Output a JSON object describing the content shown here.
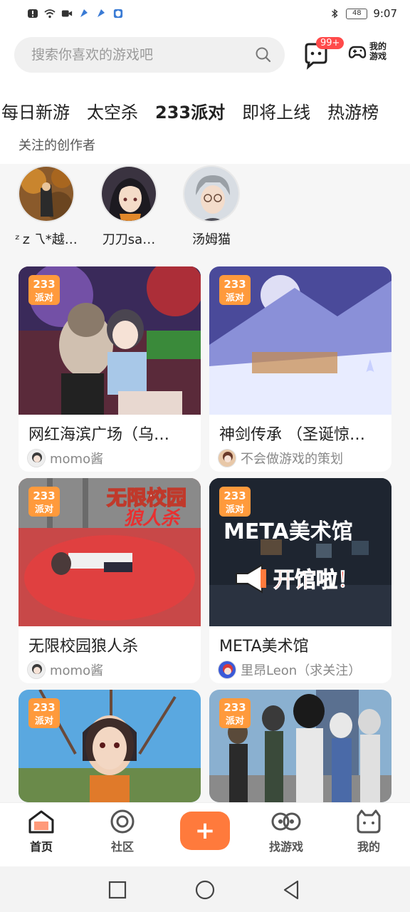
{
  "status_bar": {
    "time": "9:07",
    "battery": "48"
  },
  "header": {
    "search_placeholder": "搜索你喜欢的游戏吧",
    "message_badge": "99+",
    "my_games_label": "我的游戏"
  },
  "tabs": [
    "每日新游",
    "太空杀",
    "233派对",
    "即将上线",
    "热游榜"
  ],
  "active_tab_index": 2,
  "creators_section": {
    "title": "关注的创作者",
    "creators": [
      {
        "name": "ᶻｚ乁*越…"
      },
      {
        "name": "刀刀sa…"
      },
      {
        "name": "汤姆猫"
      }
    ]
  },
  "game_tag": "233派对",
  "games": [
    {
      "title": "网红海滨广场（乌…",
      "author": "momo酱",
      "banner_text": "",
      "banner_sub": ""
    },
    {
      "title": "神剑传承 （圣诞惊…",
      "author": "不会做游戏的策划",
      "banner_text": "",
      "banner_sub": ""
    },
    {
      "title": "无限校园狼人杀",
      "author": "momo酱",
      "banner_text": "无限校园",
      "banner_sub": "狼人杀"
    },
    {
      "title": "META美术馆",
      "author": "里昂Leon（求关注）",
      "banner_text": "META美术馆",
      "banner_sub": "开馆啦！"
    },
    {
      "title": "",
      "author": "",
      "banner_text": "",
      "banner_sub": ""
    },
    {
      "title": "",
      "author": "",
      "banner_text": "",
      "banner_sub": ""
    }
  ],
  "bottom_nav": {
    "items": [
      "首页",
      "社区",
      "找游戏",
      "我的"
    ],
    "fab": "+"
  },
  "colors": {
    "accent": "#ff7a3c",
    "badge": "#ff4a4a"
  }
}
